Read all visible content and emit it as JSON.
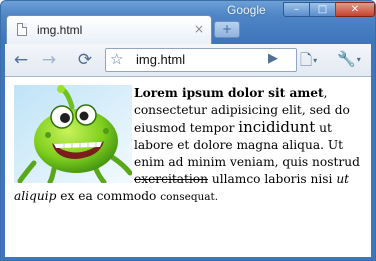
{
  "window": {
    "brand": "Google",
    "controls": {
      "minimize": "–",
      "maximize": "□",
      "close": "✕"
    }
  },
  "tab": {
    "title": "img.html",
    "close_glyph": "×",
    "icon": "page-icon"
  },
  "new_tab": {
    "glyph": "+"
  },
  "toolbar": {
    "back_glyph": "←",
    "forward_glyph": "→",
    "reload_glyph": "⟳",
    "bookmark_glyph": "☆",
    "go_glyph": "▶",
    "page_menu_glyph": "🗋",
    "wrench_glyph": "🔧",
    "caret_glyph": "▾"
  },
  "omnibox": {
    "value": "img.html"
  },
  "document": {
    "image_alt": "green cartoon monster",
    "bold_text": "Lorem ipsum dolor sit amet",
    "text_after_bold": ", consectetur adipisicing elit, sed do eiusmod tempor ",
    "big_text": "incididunt",
    "text_after_big": " ut labore et dolore magna aliqua. Ut enim ad minim veniam, quis nostrud ",
    "strike_text": "exercitation",
    "text_after_strike": " ullamco laboris nisi ",
    "italic_text": "ut aliquip",
    "text_after_italic": " ex ea commodo ",
    "small_text": "consequat."
  },
  "colors": {
    "frame": "#4f86c7",
    "toolbar": "#e2e9f2",
    "monster_body": "#7fcf1f",
    "monster_background": "#dff0fb"
  }
}
